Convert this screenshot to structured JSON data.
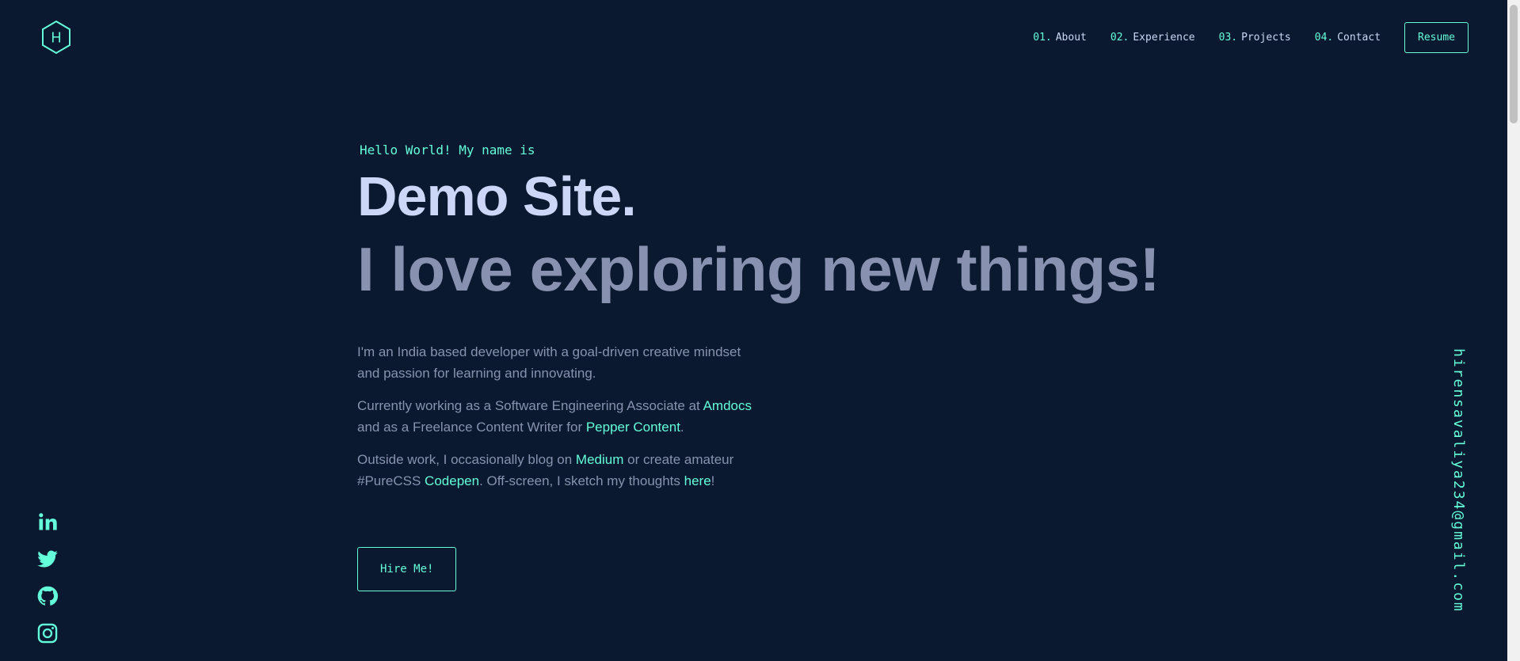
{
  "logo": {
    "letter": "H"
  },
  "nav": {
    "items": [
      {
        "num": "01.",
        "label": "About"
      },
      {
        "num": "02.",
        "label": "Experience"
      },
      {
        "num": "03.",
        "label": "Projects"
      },
      {
        "num": "04.",
        "label": "Contact"
      }
    ],
    "resume_label": "Resume"
  },
  "hero": {
    "greeting": "Hello World! My name is",
    "name": "Demo Site.",
    "tagline": "I love exploring new things!",
    "p1": "I'm an India based developer with a goal-driven creative mindset and passion for learning and innovating.",
    "p2_a": "Currently working as a Software Engineering Associate at ",
    "p2_link1": "Amdocs",
    "p2_b": " and as a Freelance Content Writer for ",
    "p2_link2": "Pepper Content",
    "p2_c": ".",
    "p3_a": "Outside work, I occasionally blog on ",
    "p3_link1": "Medium",
    "p3_b": " or create amateur #PureCSS ",
    "p3_link2": "Codepen",
    "p3_c": ". Off-screen, I sketch my thoughts ",
    "p3_link3": "here",
    "p3_d": "!",
    "hire_label": "Hire Me!"
  },
  "socials": [
    "linkedin-icon",
    "twitter-icon",
    "github-icon",
    "instagram-icon"
  ],
  "email": "hirensavaliya234@gmail.com",
  "colors": {
    "background": "#0a192f",
    "accent": "#64ffda",
    "heading": "#ccd6f6",
    "text": "#8892b0"
  }
}
